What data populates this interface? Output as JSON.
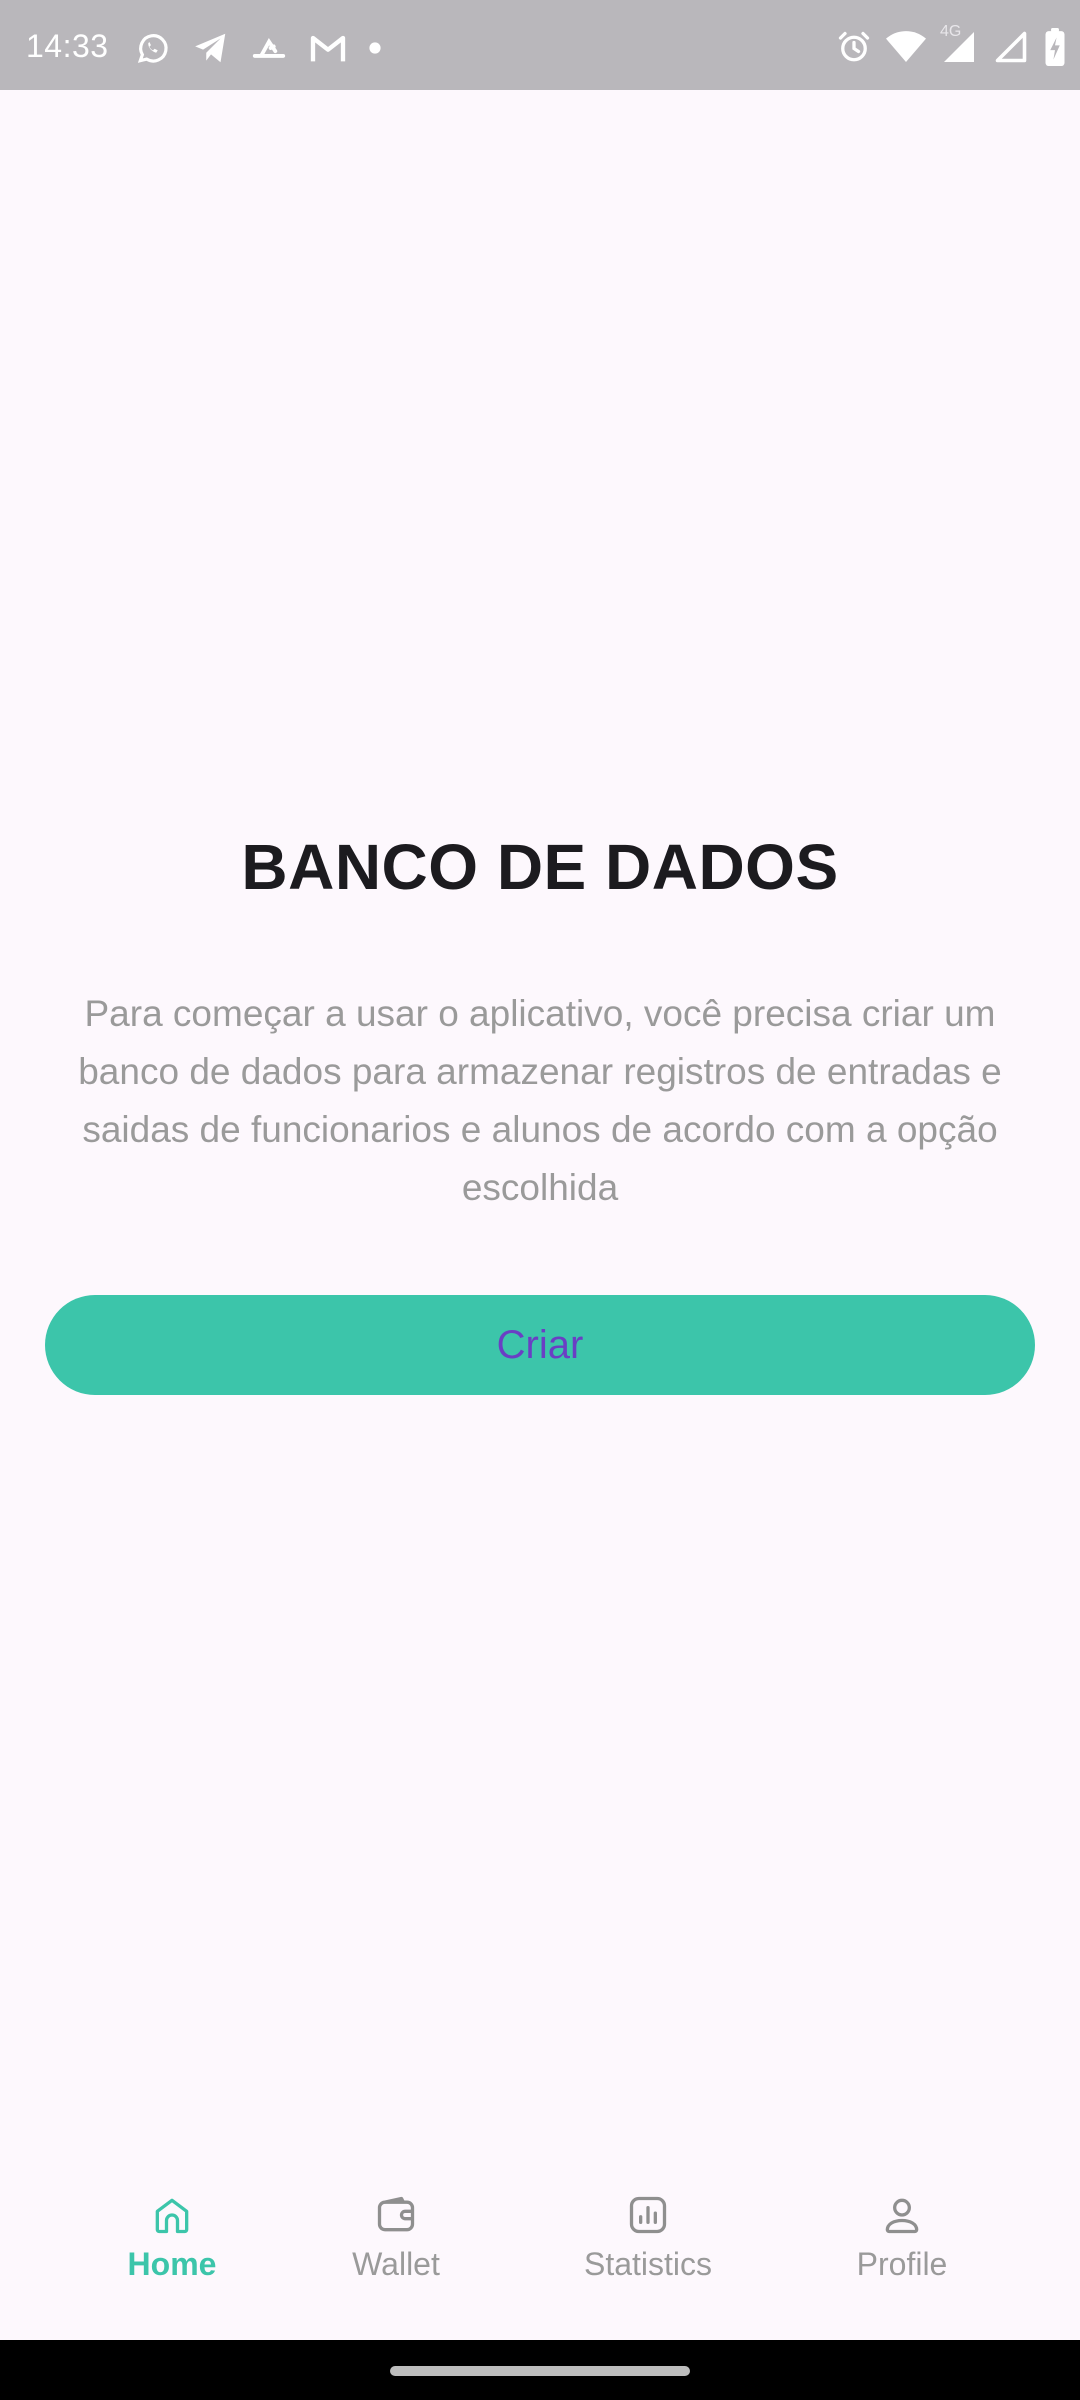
{
  "status_bar": {
    "time": "14:33",
    "network_label": "4G",
    "left_icons": [
      "whatsapp-icon",
      "telegram-icon",
      "app-notification-icon",
      "gmail-icon",
      "dot-icon"
    ],
    "right_icons": [
      "alarm-icon",
      "wifi-icon",
      "signal-icon",
      "signal-icon",
      "battery-icon"
    ]
  },
  "main": {
    "title": "BANCO DE DADOS",
    "description": "Para começar a usar o aplicativo, você precisa criar um banco de dados para armazenar registros de entradas e saidas de funcionarios e alunos de acordo com a opção escolhida",
    "create_button_label": "Criar"
  },
  "bottom_nav": {
    "items": [
      {
        "label": "Home",
        "icon": "home-icon",
        "active": true
      },
      {
        "label": "Wallet",
        "icon": "wallet-icon",
        "active": false
      },
      {
        "label": "Statistics",
        "icon": "statistics-icon",
        "active": false
      },
      {
        "label": "Profile",
        "icon": "profile-icon",
        "active": false
      }
    ]
  },
  "colors": {
    "accent": "#3cc5aa",
    "button_text": "#6a3fc4",
    "background": "#fdf8fd",
    "status_bar": "#b9b7bb",
    "muted_text": "#9a9a9a",
    "title_text": "#1c1b1f"
  }
}
